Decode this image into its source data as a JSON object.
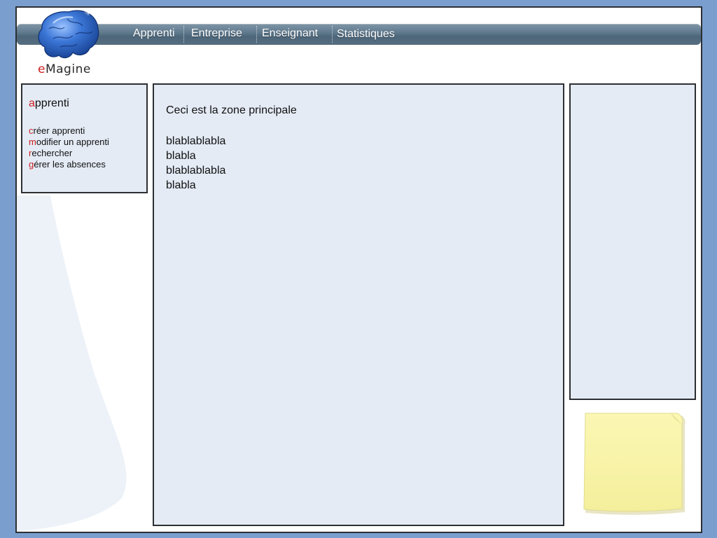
{
  "app": {
    "logo_first": "e",
    "logo_rest": "Magine"
  },
  "nav": {
    "items": [
      {
        "label": "Apprenti"
      },
      {
        "label": "Entreprise"
      },
      {
        "label": "Enseignant"
      },
      {
        "label": "Statistiques"
      }
    ]
  },
  "sidebar": {
    "title_first": "a",
    "title_rest": "pprenti",
    "items": [
      {
        "first": "c",
        "rest": "réer apprenti"
      },
      {
        "first": "m",
        "rest": "odifier un apprenti"
      },
      {
        "first": "r",
        "rest": "echercher"
      },
      {
        "first": "g",
        "rest": "érer les absences"
      }
    ]
  },
  "main": {
    "heading": "Ceci est la zone principale",
    "lines": [
      "blablablabla",
      "blabla",
      "blablablabla",
      "blabla"
    ]
  },
  "colors": {
    "accent": "#cc1f1f",
    "page_background": "#7a9fcf",
    "panel_background": "#e4ebf5",
    "sticky_note": "#f8f4a8"
  },
  "icons": {
    "logo": "brain-icon",
    "note": "sticky-note-icon"
  }
}
